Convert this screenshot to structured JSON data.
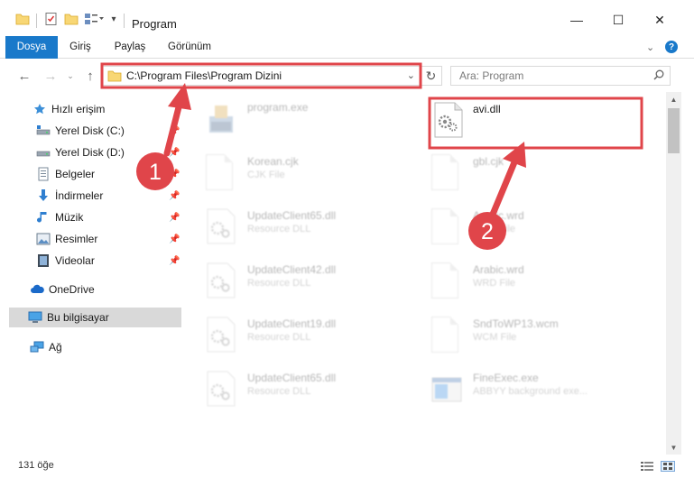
{
  "window": {
    "title": "Program",
    "controls": {
      "minimize": "—",
      "maximize": "☐",
      "close": "✕"
    }
  },
  "ribbon": {
    "tabs": [
      {
        "label": "Dosya",
        "active": true
      },
      {
        "label": "Giriş",
        "active": false
      },
      {
        "label": "Paylaş",
        "active": false
      },
      {
        "label": "Görünüm",
        "active": false
      }
    ],
    "help": "?"
  },
  "address": {
    "path": "C:\\Program Files\\Program Dizini",
    "search_placeholder": "Ara: Program"
  },
  "sidebar": {
    "items": [
      {
        "label": "Hızlı erişim",
        "icon": "star-icon",
        "pinned": false
      },
      {
        "label": "Yerel Disk (C:)",
        "icon": "drive-c-icon",
        "pinned": true
      },
      {
        "label": "Yerel Disk (D:)",
        "icon": "drive-d-icon",
        "pinned": true
      },
      {
        "label": "Belgeler",
        "icon": "documents-icon",
        "pinned": true
      },
      {
        "label": "İndirmeler",
        "icon": "downloads-icon",
        "pinned": true
      },
      {
        "label": "Müzik",
        "icon": "music-icon",
        "pinned": true
      },
      {
        "label": "Resimler",
        "icon": "pictures-icon",
        "pinned": true
      },
      {
        "label": "Videolar",
        "icon": "videos-icon",
        "pinned": true
      },
      {
        "label": "OneDrive",
        "icon": "onedrive-icon",
        "pinned": false
      },
      {
        "label": "Bu bilgisayar",
        "icon": "this-pc-icon",
        "pinned": false,
        "selected": true
      },
      {
        "label": "Ağ",
        "icon": "network-icon",
        "pinned": false
      }
    ]
  },
  "files": [
    {
      "name": "program.exe",
      "type": "",
      "icon": "program-exe-icon"
    },
    {
      "name": "avi.dll",
      "type": "",
      "icon": "dll-gear-icon",
      "highlighted": true
    },
    {
      "name": "Korean.cjk",
      "type": "CJK File",
      "icon": "document-icon"
    },
    {
      "name": "gbl.cjk",
      "type": "",
      "icon": "document-icon"
    },
    {
      "name": "UpdateClient65.dll",
      "type": "Resource DLL",
      "icon": "dll-gear-icon"
    },
    {
      "name": "Arabic.wrd",
      "type": "WRD File",
      "icon": "document-icon"
    },
    {
      "name": "UpdateClient42.dll",
      "type": "Resource DLL",
      "icon": "dll-gear-icon"
    },
    {
      "name": "Arabic.wrd",
      "type": "WRD File",
      "icon": "document-icon"
    },
    {
      "name": "UpdateClient19.dll",
      "type": "Resource DLL",
      "icon": "dll-gear-icon"
    },
    {
      "name": "SndToWP13.wcm",
      "type": "WCM File",
      "icon": "document-icon"
    },
    {
      "name": "UpdateClient65.dll",
      "type": "Resource DLL",
      "icon": "dll-gear-icon"
    },
    {
      "name": "FineExec.exe",
      "type": "ABBYY background exe...",
      "icon": "exe-window-icon"
    }
  ],
  "status": {
    "count": "131 öğe"
  },
  "annotations": {
    "step1": "1",
    "step2": "2",
    "color": "#e0454a"
  }
}
